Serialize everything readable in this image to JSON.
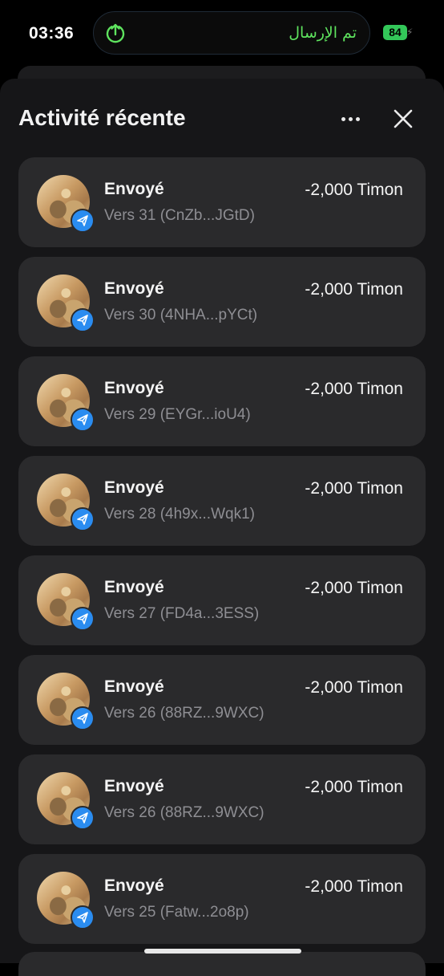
{
  "status_bar": {
    "time": "03:36",
    "island_text": "تم الإرسال",
    "battery": "84"
  },
  "header": {
    "title": "Activité récente"
  },
  "transactions": [
    {
      "label": "Envoyé",
      "subtitle": "Vers 31 (CnZb...JGtD)",
      "amount": "-2,000 Timon"
    },
    {
      "label": "Envoyé",
      "subtitle": "Vers 30 (4NHA...pYCt)",
      "amount": "-2,000 Timon"
    },
    {
      "label": "Envoyé",
      "subtitle": "Vers 29 (EYGr...ioU4)",
      "amount": "-2,000 Timon"
    },
    {
      "label": "Envoyé",
      "subtitle": "Vers 28 (4h9x...Wqk1)",
      "amount": "-2,000 Timon"
    },
    {
      "label": "Envoyé",
      "subtitle": "Vers 27 (FD4a...3ESS)",
      "amount": "-2,000 Timon"
    },
    {
      "label": "Envoyé",
      "subtitle": "Vers 26 (88RZ...9WXC)",
      "amount": "-2,000 Timon"
    },
    {
      "label": "Envoyé",
      "subtitle": "Vers 26 (88RZ...9WXC)",
      "amount": "-2,000 Timon"
    },
    {
      "label": "Envoyé",
      "subtitle": "Vers 25 (Fatw...2o8p)",
      "amount": "-2,000 Timon"
    }
  ],
  "icons": {
    "upload": "upload-icon",
    "more": "more-dots-icon",
    "close": "close-icon",
    "send_badge": "send-arrow-icon"
  },
  "colors": {
    "accent_green": "#5ee35e",
    "badge_blue": "#2a8cf0",
    "card_bg": "#2a2a2c",
    "battery_green": "#33c759"
  }
}
